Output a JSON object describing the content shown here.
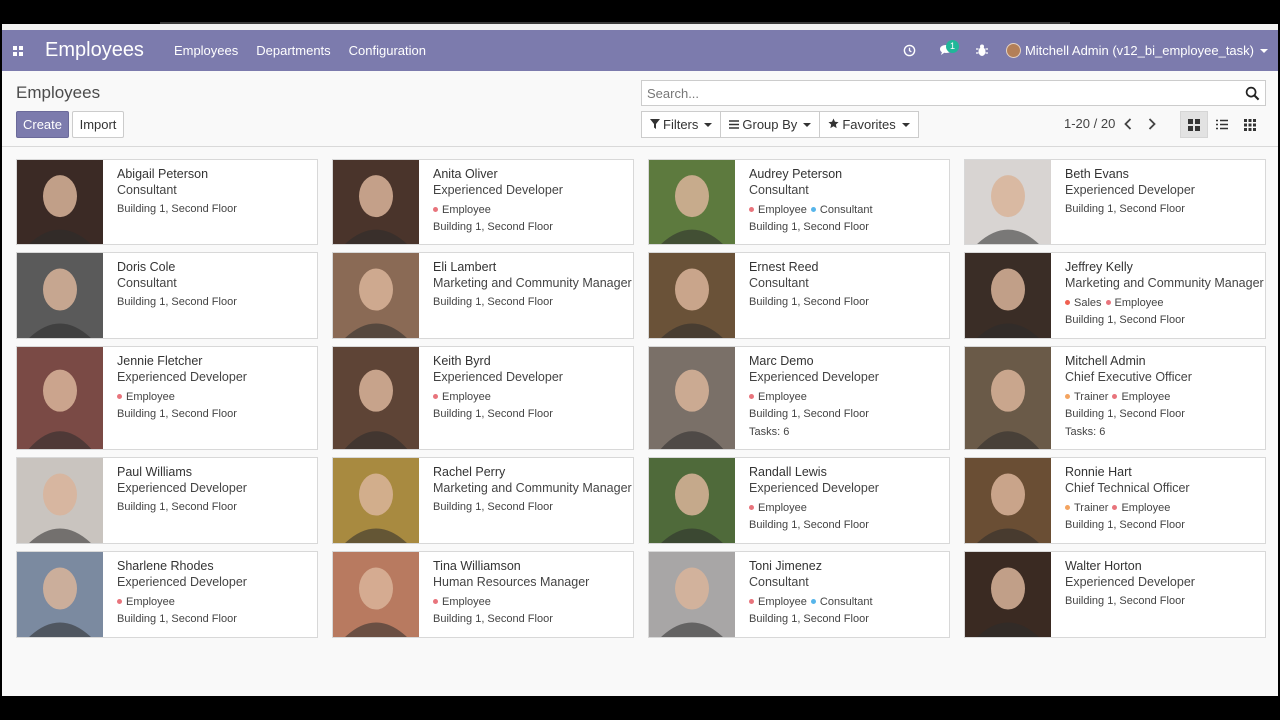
{
  "navbar": {
    "app_title": "Employees",
    "menu": [
      "Employees",
      "Departments",
      "Configuration"
    ],
    "message_count": "1",
    "user_name": "Mitchell Admin (v12_bi_employee_task)"
  },
  "control": {
    "breadcrumb": "Employees",
    "create_label": "Create",
    "import_label": "Import",
    "search_placeholder": "Search...",
    "filters_label": "Filters",
    "groupby_label": "Group By",
    "favorites_label": "Favorites",
    "pager": "1-20 / 20"
  },
  "tag_colors": {
    "Employee": "#e8747c",
    "Consultant": "#57b5ea",
    "Sales": "#f06050",
    "Trainer": "#f4a460"
  },
  "employees": [
    {
      "name": "Abigail Peterson",
      "job": "Consultant",
      "tags": [],
      "location": "Building 1, Second Floor",
      "tasks": "",
      "photo": "#3b2a25"
    },
    {
      "name": "Anita Oliver",
      "job": "Experienced Developer",
      "tags": [
        "Employee"
      ],
      "location": "Building 1, Second Floor",
      "tasks": "",
      "photo": "#4a342b"
    },
    {
      "name": "Audrey Peterson",
      "job": "Consultant",
      "tags": [
        "Employee",
        "Consultant"
      ],
      "location": "Building 1, Second Floor",
      "tasks": "",
      "photo": "#5d7a3e"
    },
    {
      "name": "Beth Evans",
      "job": "Experienced Developer",
      "tags": [],
      "location": "Building 1, Second Floor",
      "tasks": "",
      "photo": "#d8d4d2"
    },
    {
      "name": "Doris Cole",
      "job": "Consultant",
      "tags": [],
      "location": "Building 1, Second Floor",
      "tasks": "",
      "photo": "#5a5a5a"
    },
    {
      "name": "Eli Lambert",
      "job": "Marketing and Community Manager",
      "tags": [],
      "location": "Building 1, Second Floor",
      "tasks": "",
      "photo": "#8a6a55"
    },
    {
      "name": "Ernest Reed",
      "job": "Consultant",
      "tags": [],
      "location": "Building 1, Second Floor",
      "tasks": "",
      "photo": "#6a5238"
    },
    {
      "name": "Jeffrey Kelly",
      "job": "Marketing and Community Manager",
      "tags": [
        "Sales",
        "Employee"
      ],
      "location": "Building 1, Second Floor",
      "tasks": "",
      "photo": "#3a2d26"
    },
    {
      "name": "Jennie Fletcher",
      "job": "Experienced Developer",
      "tags": [
        "Employee"
      ],
      "location": "Building 1, Second Floor",
      "tasks": "",
      "photo": "#7a4a45"
    },
    {
      "name": "Keith Byrd",
      "job": "Experienced Developer",
      "tags": [
        "Employee"
      ],
      "location": "Building 1, Second Floor",
      "tasks": "",
      "photo": "#5e4436"
    },
    {
      "name": "Marc Demo",
      "job": "Experienced Developer",
      "tags": [
        "Employee"
      ],
      "location": "Building 1, Second Floor",
      "tasks": "Tasks: 6",
      "photo": "#7a7068"
    },
    {
      "name": "Mitchell Admin",
      "job": "Chief Executive Officer",
      "tags": [
        "Trainer",
        "Employee"
      ],
      "location": "Building 1, Second Floor",
      "tasks": "Tasks: 6",
      "photo": "#6a5a48"
    },
    {
      "name": "Paul Williams",
      "job": "Experienced Developer",
      "tags": [],
      "location": "Building 1, Second Floor",
      "tasks": "",
      "photo": "#c9c4bf"
    },
    {
      "name": "Rachel Perry",
      "job": "Marketing and Community Manager",
      "tags": [],
      "location": "Building 1, Second Floor",
      "tasks": "",
      "photo": "#a88a40"
    },
    {
      "name": "Randall Lewis",
      "job": "Experienced Developer",
      "tags": [
        "Employee"
      ],
      "location": "Building 1, Second Floor",
      "tasks": "",
      "photo": "#4f6a3a"
    },
    {
      "name": "Ronnie Hart",
      "job": "Chief Technical Officer",
      "tags": [
        "Trainer",
        "Employee"
      ],
      "location": "Building 1, Second Floor",
      "tasks": "",
      "photo": "#6a4e34"
    },
    {
      "name": "Sharlene Rhodes",
      "job": "Experienced Developer",
      "tags": [
        "Employee"
      ],
      "location": "Building 1, Second Floor",
      "tasks": "",
      "photo": "#7b8aa0"
    },
    {
      "name": "Tina Williamson",
      "job": "Human Resources Manager",
      "tags": [
        "Employee"
      ],
      "location": "Building 1, Second Floor",
      "tasks": "",
      "photo": "#b87a60"
    },
    {
      "name": "Toni Jimenez",
      "job": "Consultant",
      "tags": [
        "Employee",
        "Consultant"
      ],
      "location": "Building 1, Second Floor",
      "tasks": "",
      "photo": "#a8a6a6"
    },
    {
      "name": "Walter Horton",
      "job": "Experienced Developer",
      "tags": [],
      "location": "Building 1, Second Floor",
      "tasks": "",
      "photo": "#3a2a22"
    }
  ]
}
